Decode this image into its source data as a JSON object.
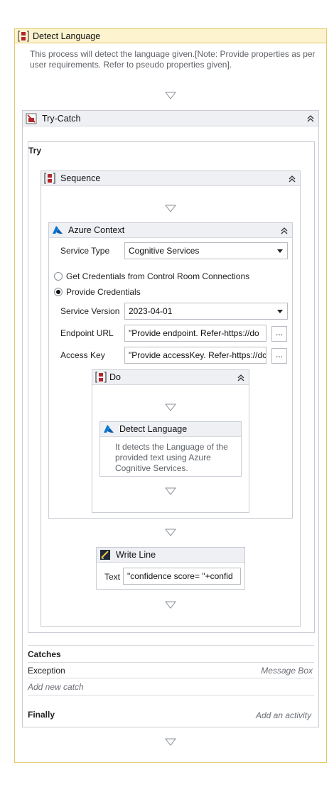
{
  "outer": {
    "title": "Detect Language",
    "description": "This process will detect the language given.[Note: Provide properties as per user requirements. Refer to pseudo properties given]."
  },
  "try_catch": {
    "title": "Try-Catch",
    "try_label": "Try",
    "catches_label": "Catches",
    "exception_label": "Exception",
    "exception_activity": "Message Box",
    "add_new_catch": "Add new catch",
    "finally_label": "Finally",
    "finally_placeholder": "Add an activity"
  },
  "sequence": {
    "title": "Sequence"
  },
  "azure_context": {
    "title": "Azure Context",
    "service_type_label": "Service Type",
    "service_type_value": "Cognitive Services",
    "radio_control_room": "Get Credentials from Control Room Connections",
    "radio_provide": "Provide Credentials",
    "selected_radio": "Provide Credentials",
    "service_version_label": "Service Version",
    "service_version_value": "2023-04-01",
    "endpoint_label": "Endpoint URL",
    "endpoint_value": "\"Provide endpoint. Refer-https://do",
    "access_key_label": "Access Key",
    "access_key_value": "\"Provide accessKey. Refer-https://dc",
    "ellipsis": "..."
  },
  "do_block": {
    "title": "Do"
  },
  "detect_language_activity": {
    "title": "Detect Language",
    "description": "It detects the Language of the provided text using Azure Cognitive Services."
  },
  "write_line": {
    "title": "Write Line",
    "text_label": "Text",
    "text_value": "\"confidence score=  \"+confid"
  },
  "colors": {
    "outer_header_bg": "#fdf3cf",
    "outer_border": "#e3c96b",
    "azure_blue": "#0078d4",
    "sequence_red": "#b3262d"
  },
  "icons": {
    "outer": "sequence-bracket-icon",
    "try_catch": "try-catch-icon",
    "azure": "azure-icon",
    "write_line": "write-line-icon",
    "collapse": "double-chevron-up-icon",
    "drop": "drop-target-arrow-icon"
  }
}
